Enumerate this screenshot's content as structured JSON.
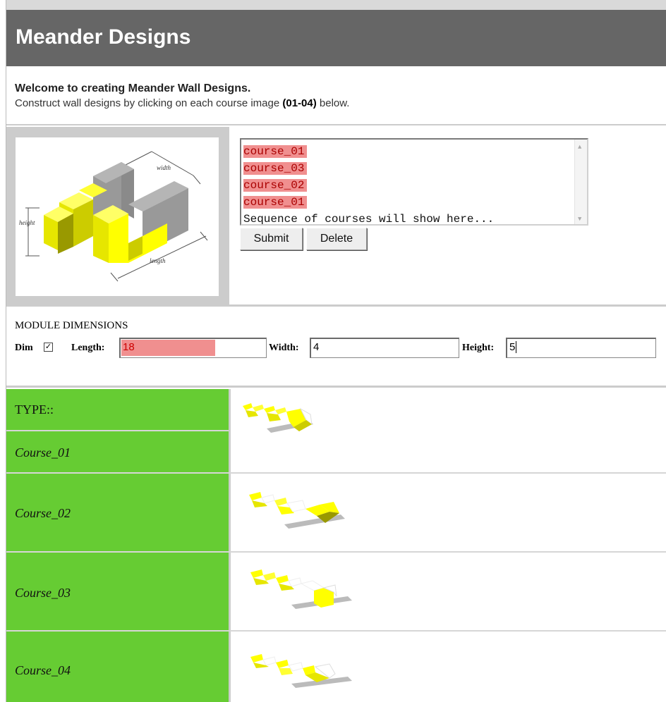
{
  "header": {
    "title": "Meander Designs"
  },
  "welcome": {
    "title": "Welcome to creating Meander Wall Designs.",
    "desc_before": "Construct wall designs by clicking on each course image ",
    "desc_bold": "(01-04)",
    "desc_after": " below."
  },
  "diagram": {
    "width_label": "width",
    "height_label": "height",
    "length_label": "length"
  },
  "sequence": {
    "items": [
      "course_01",
      "course_03",
      "course_02",
      "course_01"
    ],
    "placeholder": "Sequence of courses will show here..."
  },
  "buttons": {
    "submit": "Submit",
    "delete": "Delete"
  },
  "dimensions": {
    "title": "MODULE DIMENSIONS",
    "dim_label": "Dim",
    "dim_checked": true,
    "length_label": "Length:",
    "length_value": "18",
    "width_label": "Width:",
    "width_value": "4",
    "height_label": "Height:",
    "height_value": "5"
  },
  "types": {
    "header": "TYPE::",
    "courses": [
      "Course_01",
      "Course_02",
      "Course_03",
      "Course_04"
    ]
  },
  "colors": {
    "header_bg": "#666666",
    "type_green": "#66cc33",
    "highlight": "#f08f8f",
    "block_yellow": "#ffff00"
  }
}
